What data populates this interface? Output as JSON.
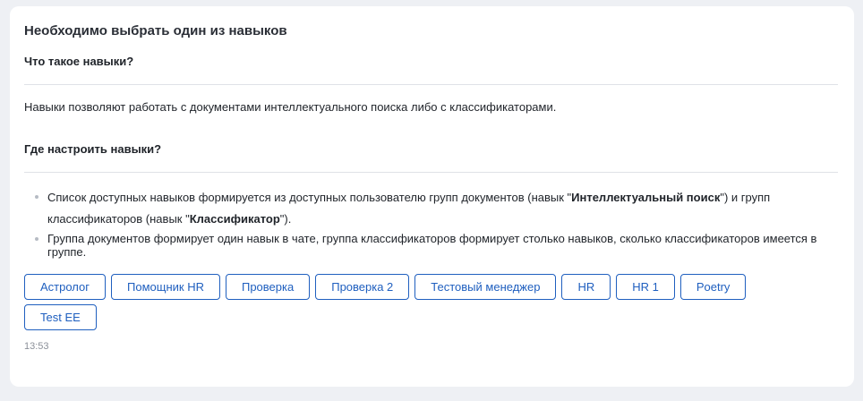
{
  "message": {
    "title": "Необходимо выбрать один из навыков",
    "section1_heading": "Что такое навыки?",
    "section1_text": "Навыки позволяют работать с документами интеллектуального поиска либо с классификаторами.",
    "section2_heading": "Где настроить навыки?",
    "bullet1_part1": "Список доступных навыков формируется из доступных пользователю групп документов (навык \"",
    "bullet1_bold1": "Интеллектуальный поиск",
    "bullet1_part2": "\") и групп классификаторов (навык \"",
    "bullet1_bold2": "Классификатор",
    "bullet1_part3": "\").",
    "bullet2": "Группа документов формирует один навык в чате, группа классификаторов формирует столько навыков, сколько классификаторов имеется в группе.",
    "skills": [
      "Астролог",
      "Помощник HR",
      "Проверка",
      "Проверка 2",
      "Тестовый менеджер",
      "HR",
      "HR 1",
      "Poetry",
      "Test EE"
    ],
    "timestamp": "13:53"
  },
  "colors": {
    "accent": "#1f5fbf",
    "background": "#eef0f4",
    "card": "#ffffff",
    "divider": "#dfe2e7"
  }
}
